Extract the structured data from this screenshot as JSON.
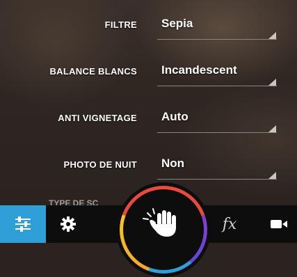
{
  "settings": [
    {
      "label": "FILTRE",
      "value": "Sepia"
    },
    {
      "label": "BALANCE BLANCS",
      "value": "Incandescent"
    },
    {
      "label": "ANTI VIGNETAGE",
      "value": "Auto"
    },
    {
      "label": "PHOTO DE NUIT",
      "value": "Non"
    }
  ],
  "partial_label": "TYPE DE SC",
  "toolbar": {
    "items": [
      "sliders-icon",
      "gear-icon",
      "hand-gesture-icon",
      "fx-icon",
      "video-camera-icon"
    ],
    "active": "sliders-icon",
    "fx_text": "fx",
    "accent": "#2f9fd8"
  }
}
